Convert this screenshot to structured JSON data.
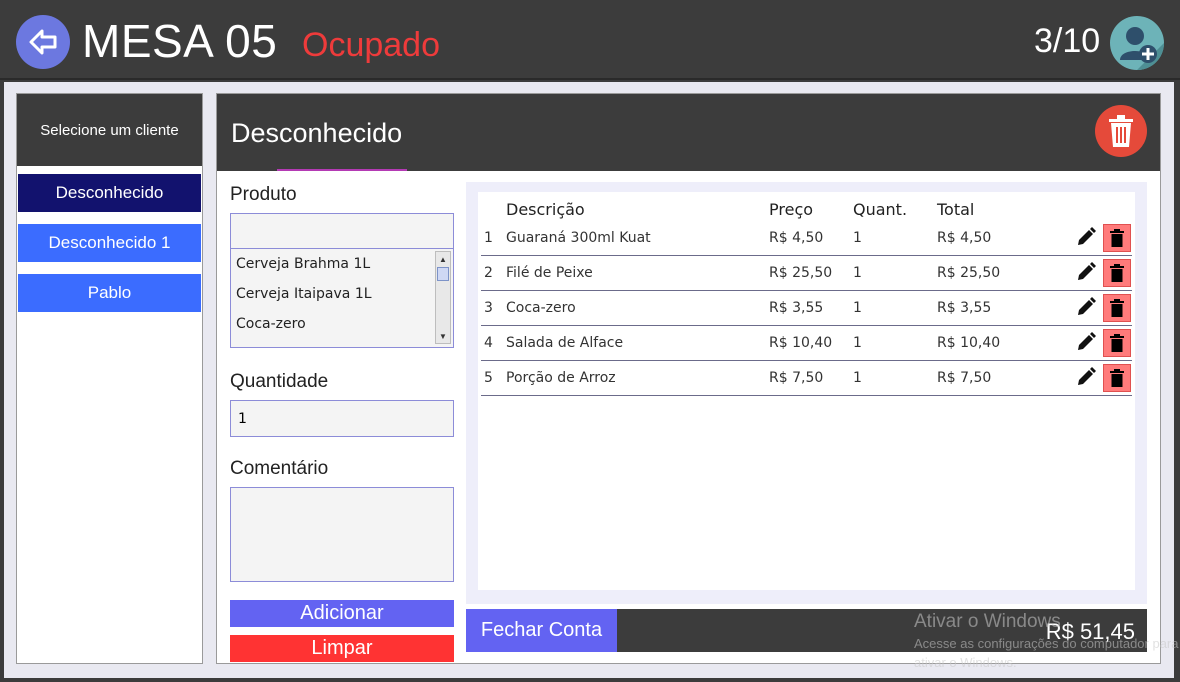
{
  "header": {
    "title": "MESA 05",
    "status": "Ocupado",
    "counter": "3/10"
  },
  "sidebar": {
    "header": "Selecione um cliente",
    "clients": [
      {
        "label": "Desconhecido"
      },
      {
        "label": "Desconhecido 1"
      },
      {
        "label": "Pablo"
      }
    ]
  },
  "panel": {
    "title": "Desconhecido"
  },
  "form": {
    "product_label": "Produto",
    "product_search_value": "",
    "products": [
      "Cerveja Brahma 1L",
      "Cerveja Itaipava 1L",
      "Coca-zero"
    ],
    "quantity_label": "Quantidade",
    "quantity_value": "1",
    "comment_label": "Comentário",
    "comment_value": "",
    "add_label": "Adicionar",
    "clear_label": "Limpar"
  },
  "orders": {
    "columns": {
      "description": "Descrição",
      "price": "Preço",
      "quantity": "Quant.",
      "total": "Total"
    },
    "rows": [
      {
        "num": "1",
        "description": "Guaraná 300ml Kuat",
        "price": "R$ 4,50",
        "quantity": "1",
        "total": "R$ 4,50"
      },
      {
        "num": "2",
        "description": "Filé de Peixe",
        "price": "R$ 25,50",
        "quantity": "1",
        "total": "R$ 25,50"
      },
      {
        "num": "3",
        "description": "Coca-zero",
        "price": "R$ 3,55",
        "quantity": "1",
        "total": "R$ 3,55"
      },
      {
        "num": "4",
        "description": "Salada de Alface",
        "price": "R$ 10,40",
        "quantity": "1",
        "total": "R$ 10,40"
      },
      {
        "num": "5",
        "description": "Porção de Arroz",
        "price": "R$ 7,50",
        "quantity": "1",
        "total": "R$ 7,50"
      }
    ]
  },
  "footer": {
    "close_label": "Fechar Conta",
    "total": "R$ 51,45"
  },
  "watermark": {
    "line1": "Ativar o Windows",
    "line2": "Acesse as configurações do computador para",
    "line3": "ativar o Windows."
  },
  "colors": {
    "header_bg": "#3c3c3c",
    "status": "#ee3b3b",
    "active_client": "#12126e",
    "client": "#3b6cff",
    "add_button": "#6363f2",
    "clear_button": "#ff3333",
    "delete_row": "#ff7b7b"
  },
  "icons": {
    "back": "arrow-left-icon",
    "add_user": "add-user-icon",
    "delete_client": "trash-icon",
    "edit": "pencil-icon",
    "delete": "trash-icon"
  }
}
